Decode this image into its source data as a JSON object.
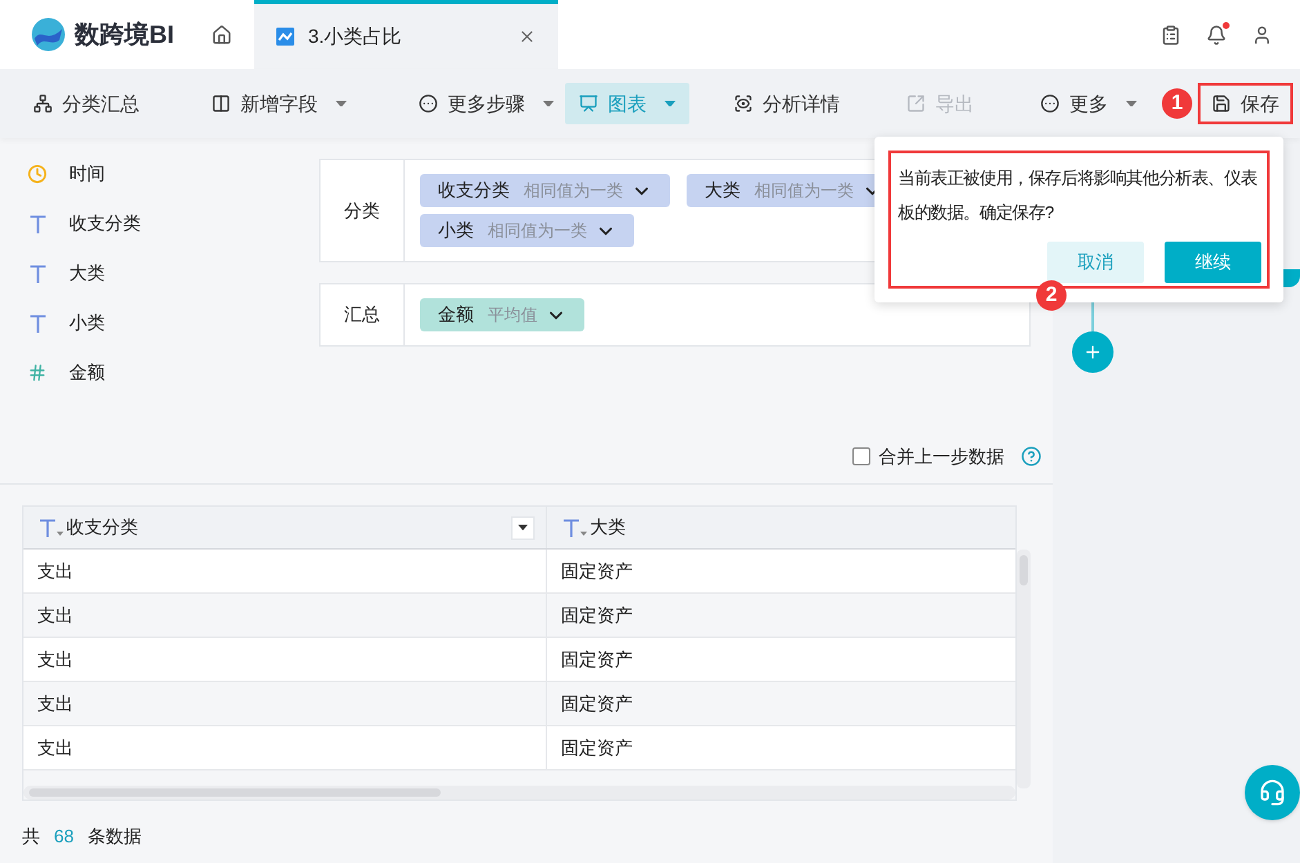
{
  "app": {
    "name": "数跨境BI"
  },
  "tabs": [
    {
      "label": "3.小类占比",
      "selected": true
    }
  ],
  "notifications": {
    "unread": true
  },
  "toolbar": [
    {
      "label": "分类汇总",
      "dropdown": false,
      "selected": false,
      "disabled": false,
      "highlighted": false
    },
    {
      "label": "新增字段",
      "dropdown": true,
      "selected": false,
      "disabled": false,
      "highlighted": false
    },
    {
      "label": "更多步骤",
      "dropdown": true,
      "selected": false,
      "disabled": false,
      "highlighted": false
    },
    {
      "label": "图表",
      "dropdown": true,
      "selected": true,
      "disabled": false,
      "highlighted": false
    },
    {
      "label": "分析详情",
      "dropdown": false,
      "selected": false,
      "disabled": false,
      "highlighted": false
    },
    {
      "label": "导出",
      "dropdown": false,
      "selected": false,
      "disabled": true,
      "highlighted": false
    },
    {
      "label": "更多",
      "dropdown": true,
      "selected": false,
      "disabled": false,
      "highlighted": false
    },
    {
      "label": "保存",
      "dropdown": false,
      "selected": false,
      "disabled": false,
      "highlighted": true,
      "callout": "1"
    }
  ],
  "fields": [
    {
      "name": "时间",
      "kind": "date"
    },
    {
      "name": "收支分类",
      "kind": "text"
    },
    {
      "name": "大类",
      "kind": "text"
    },
    {
      "name": "小类",
      "kind": "text"
    },
    {
      "name": "金额",
      "kind": "number"
    }
  ],
  "groups": [
    {
      "label": "分类",
      "kind": "dimension",
      "chips": [
        {
          "name": "收支分类",
          "option": "相同值为一类"
        },
        {
          "name": "大类",
          "option": "相同值为一类"
        },
        {
          "name": "小类",
          "option": "相同值为一类"
        }
      ]
    },
    {
      "label": "汇总",
      "kind": "measure",
      "chips": [
        {
          "name": "金额",
          "option": "平均值"
        }
      ]
    }
  ],
  "merge_checkbox": {
    "label": "合并上一步数据",
    "checked": false
  },
  "table": {
    "columns": [
      {
        "label": "收支分类",
        "filter": true
      },
      {
        "label": "大类",
        "filter": false
      }
    ],
    "rows": [
      [
        "支出",
        "固定资产"
      ],
      [
        "支出",
        "固定资产"
      ],
      [
        "支出",
        "固定资产"
      ],
      [
        "支出",
        "固定资产"
      ],
      [
        "支出",
        "固定资产"
      ]
    ]
  },
  "footer": {
    "prefix": "共",
    "count": "68",
    "suffix": "条数据"
  },
  "confirm_popover": {
    "message": "当前表正被使用，保存后将影响其他分析表、仪表板的数据。确定保存?",
    "highlighted": true,
    "callout": "2",
    "buttons": [
      {
        "label": "取消",
        "kind": "secondary"
      },
      {
        "label": "继续",
        "kind": "primary"
      }
    ]
  }
}
